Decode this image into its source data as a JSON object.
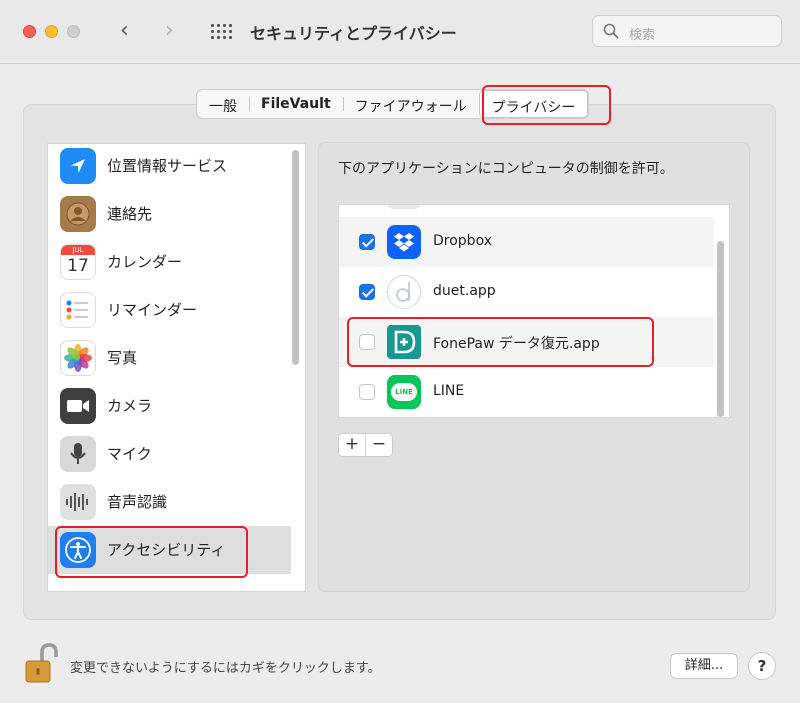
{
  "window": {
    "title": "セキュリティとプライバシー",
    "search_placeholder": "検索"
  },
  "tabs": [
    {
      "label": "一般"
    },
    {
      "label": "FileVault"
    },
    {
      "label": "ファイアウォール"
    },
    {
      "label": "プライバシー",
      "active": true
    }
  ],
  "sidebar": {
    "items": [
      {
        "label": "位置情報サービス",
        "icon": "location-arrow-icon"
      },
      {
        "label": "連絡先",
        "icon": "contacts-icon"
      },
      {
        "label": "カレンダー",
        "icon": "calendar-icon",
        "month": "JUL",
        "day": "17"
      },
      {
        "label": "リマインダー",
        "icon": "reminders-icon"
      },
      {
        "label": "写真",
        "icon": "photos-icon"
      },
      {
        "label": "カメラ",
        "icon": "camera-icon"
      },
      {
        "label": "マイク",
        "icon": "microphone-icon"
      },
      {
        "label": "音声認識",
        "icon": "speech-recognition-icon"
      },
      {
        "label": "アクセシビリティ",
        "icon": "accessibility-icon",
        "selected": true
      }
    ]
  },
  "main": {
    "description": "下のアプリケーションにコンピュータの制御を許可。",
    "apps": [
      {
        "label": "Dropbox",
        "checked": true,
        "icon": "dropbox-icon"
      },
      {
        "label": "duet.app",
        "checked": true,
        "icon": "duet-icon"
      },
      {
        "label": "FonePaw データ復元.app",
        "checked": false,
        "icon": "fonepaw-icon"
      },
      {
        "label": "LINE",
        "checked": false,
        "icon": "line-icon",
        "icon_text": "LINE"
      }
    ],
    "add_label": "+",
    "remove_label": "−"
  },
  "footer": {
    "lock_text": "変更できないようにするにはカギをクリックします。",
    "detail_label": "詳細...",
    "help_label": "?"
  },
  "colors": {
    "highlight": "#e41e2b",
    "checkbox_on": "#1a73e8"
  }
}
